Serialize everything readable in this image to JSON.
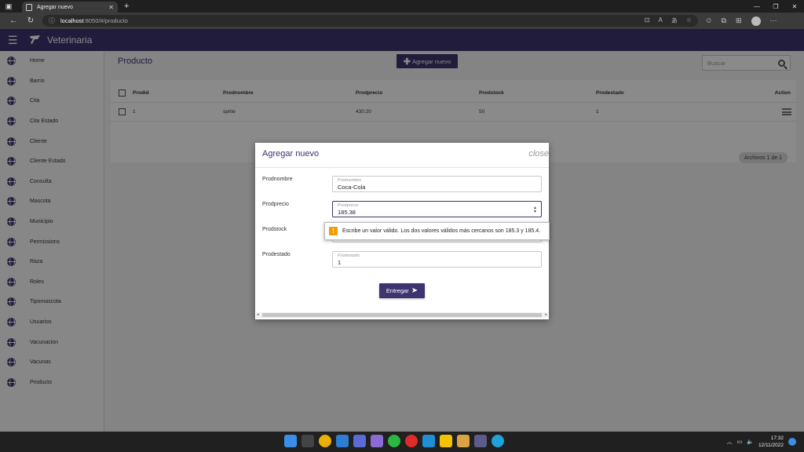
{
  "browser": {
    "tab_title": "Agregar nuevo",
    "url_host": "localhost",
    "url_path": ":8050/#/producto"
  },
  "app": {
    "brand": "Veterinaria"
  },
  "sidebar": {
    "items": [
      {
        "label": "Home"
      },
      {
        "label": "Barrio"
      },
      {
        "label": "Cita"
      },
      {
        "label": "Cita Estado"
      },
      {
        "label": "Cliente"
      },
      {
        "label": "Cliente Estado"
      },
      {
        "label": "Consulta"
      },
      {
        "label": "Mascota"
      },
      {
        "label": "Municipio"
      },
      {
        "label": "Permissions"
      },
      {
        "label": "Raza"
      },
      {
        "label": "Roles"
      },
      {
        "label": "Tipomascota"
      },
      {
        "label": "Usuarios"
      },
      {
        "label": "Vacunacion"
      },
      {
        "label": "Vacunas"
      },
      {
        "label": "Producto"
      }
    ]
  },
  "page": {
    "title": "Producto",
    "add_label": "Agregar nuevo",
    "search_placeholder": "Buscar"
  },
  "table": {
    "headers": [
      "Prodid",
      "Prodnombre",
      "Prodprecio",
      "Prodstock",
      "Prodestado",
      "Action"
    ],
    "rows": [
      [
        "1",
        "sprite",
        "430.20",
        "50",
        "1"
      ]
    ],
    "pager": "Archivos 1 de 1"
  },
  "dialog": {
    "title": "Agregar nuevo",
    "close": "close",
    "fields": [
      {
        "label": "Prodnombre",
        "placeholder": "Prodnombre",
        "value": "Coca-Cola"
      },
      {
        "label": "Prodprecio",
        "placeholder": "Prodprecio",
        "value": "185.38"
      },
      {
        "label": "Prodstock",
        "placeholder": "",
        "value": ""
      },
      {
        "label": "Prodestado",
        "placeholder": "Prodestado",
        "value": "1"
      }
    ],
    "submit": "Entregar",
    "validation_message": "Escribe un valor válido. Los dos valores válidos más cercanos son 185.3 y 185.4."
  },
  "taskbar": {
    "time": "17:32",
    "date": "12/11/2022"
  },
  "colors": {
    "primary": "#3d3470",
    "warning": "#f29d00"
  }
}
